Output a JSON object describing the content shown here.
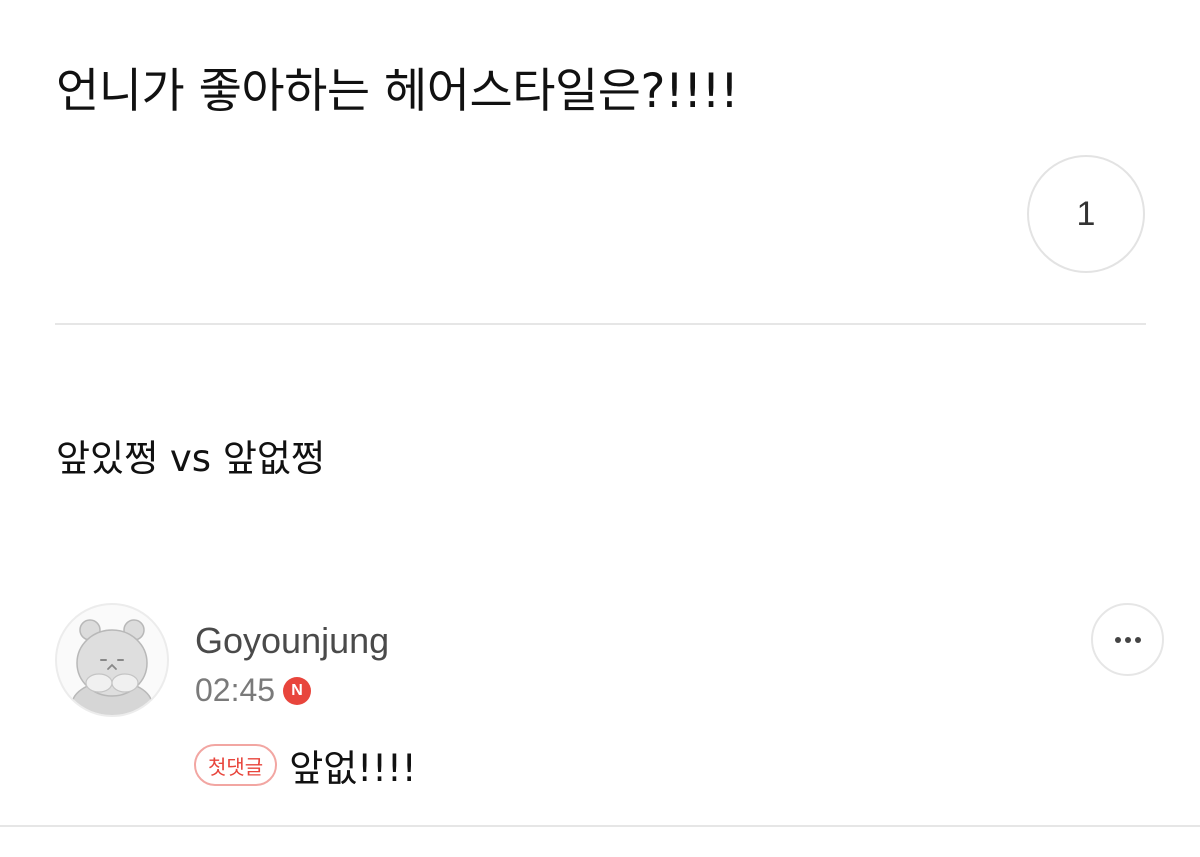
{
  "post": {
    "title": "언니가 좋아하는 헤어스타일은?!!!!",
    "body": "앞있쩡 vs 앞없쩡",
    "count": "1"
  },
  "comment": {
    "author": "Goyounjung",
    "time": "02:45",
    "new_badge": "N",
    "first_badge": "첫댓글",
    "text": "앞없!!!!"
  },
  "icons": {
    "avatar": "hamster-avatar-icon",
    "more": "more-dots-icon"
  },
  "colors": {
    "accent_red": "#e8453c",
    "badge_border": "#f2a6a2",
    "divider": "#e6e6e6"
  }
}
